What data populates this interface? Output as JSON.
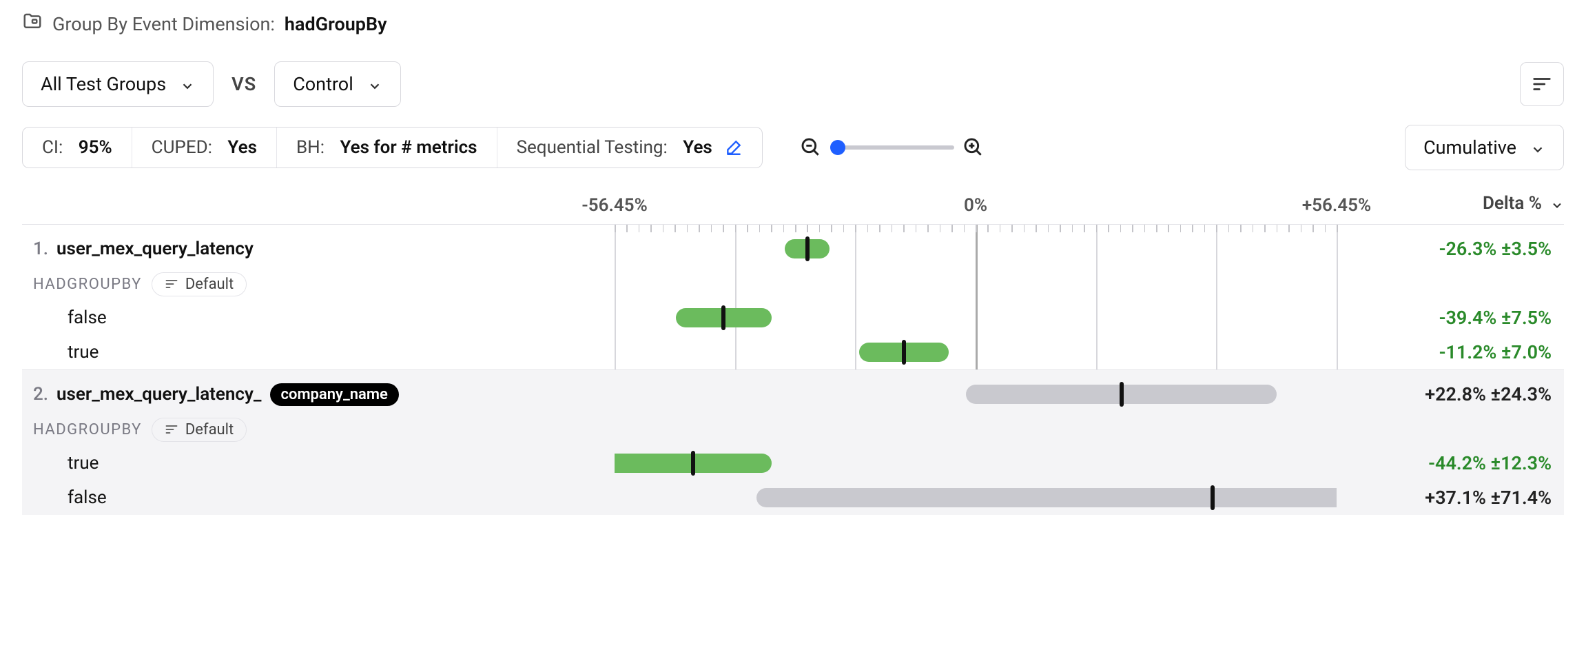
{
  "header": {
    "group_by_label": "Group By Event Dimension:",
    "group_by_value": "hadGroupBy"
  },
  "controls": {
    "test_groups_label": "All Test Groups",
    "vs_label": "VS",
    "control_label": "Control",
    "cumulative_label": "Cumulative"
  },
  "settings": {
    "ci_label": "CI:",
    "ci_value": "95%",
    "cuped_label": "CUPED:",
    "cuped_value": "Yes",
    "bh_label": "BH:",
    "bh_value": "Yes for # metrics",
    "seq_label": "Sequential Testing:",
    "seq_value": "Yes"
  },
  "axis": {
    "neg": "-56.45%",
    "zero": "0%",
    "pos": "+56.45%",
    "delta_header": "Delta %"
  },
  "groupby_sub": {
    "label": "HADGROUPBY",
    "sort": "Default"
  },
  "metrics": [
    {
      "index": "1.",
      "name": "user_mex_query_latency",
      "pill": null,
      "alt": false,
      "summary": {
        "delta": "-26.3% ±3.5%",
        "color": "green"
      },
      "rows": [
        {
          "label": "false",
          "delta": "-39.4% ±7.5%",
          "color": "green"
        },
        {
          "label": "true",
          "delta": "-11.2% ±7.0%",
          "color": "green"
        }
      ]
    },
    {
      "index": "2.",
      "name": "user_mex_query_latency_",
      "pill": "company_name",
      "alt": true,
      "summary": {
        "delta": "+22.8% ±24.3%",
        "color": "neutral"
      },
      "rows": [
        {
          "label": "true",
          "delta": "-44.2% ±12.3%",
          "color": "green"
        },
        {
          "label": "false",
          "delta": "+37.1% ±71.4%",
          "color": "neutral"
        }
      ]
    }
  ],
  "chart_data": {
    "type": "bar",
    "xlabel": "Delta %",
    "xlim": [
      -56.45,
      56.45
    ],
    "series": [
      {
        "metric": "user_mex_query_latency",
        "summary": {
          "estimate": -26.3,
          "ci_halfwidth": 3.5,
          "significant": true
        },
        "breakdown": [
          {
            "group": "false",
            "estimate": -39.4,
            "ci_halfwidth": 7.5,
            "significant": true
          },
          {
            "group": "true",
            "estimate": -11.2,
            "ci_halfwidth": 7.0,
            "significant": true
          }
        ]
      },
      {
        "metric": "user_mex_query_latency_company_name",
        "summary": {
          "estimate": 22.8,
          "ci_halfwidth": 24.3,
          "significant": false
        },
        "breakdown": [
          {
            "group": "true",
            "estimate": -44.2,
            "ci_halfwidth": 12.3,
            "significant": true
          },
          {
            "group": "false",
            "estimate": 37.1,
            "ci_halfwidth": 71.4,
            "significant": false
          }
        ]
      }
    ]
  }
}
